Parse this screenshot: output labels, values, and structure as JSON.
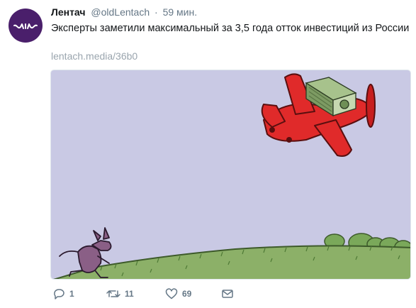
{
  "tweet": {
    "author_name": "Лентач",
    "author_handle": "@oldLentach",
    "separator": "·",
    "time": "59 мин.",
    "text": "Эксперты заметили максимальный за 3,5 года отток инвестиций из России",
    "link": "lentach.media/36b0"
  },
  "actions": {
    "reply_count": "1",
    "retweet_count": "11",
    "like_count": "69"
  },
  "icons": {
    "avatar": "lentach-logo-icon",
    "reply": "reply-icon",
    "retweet": "retweet-icon",
    "like": "heart-icon",
    "message": "envelope-icon"
  },
  "colors": {
    "text": "#14171a",
    "secondary": "#657786",
    "link": "#9aa5ae",
    "avatar_bg": "#4a1f6b",
    "sky": "#c8c8e3",
    "grass": "#8db06a",
    "plane": "#e02a2a"
  }
}
